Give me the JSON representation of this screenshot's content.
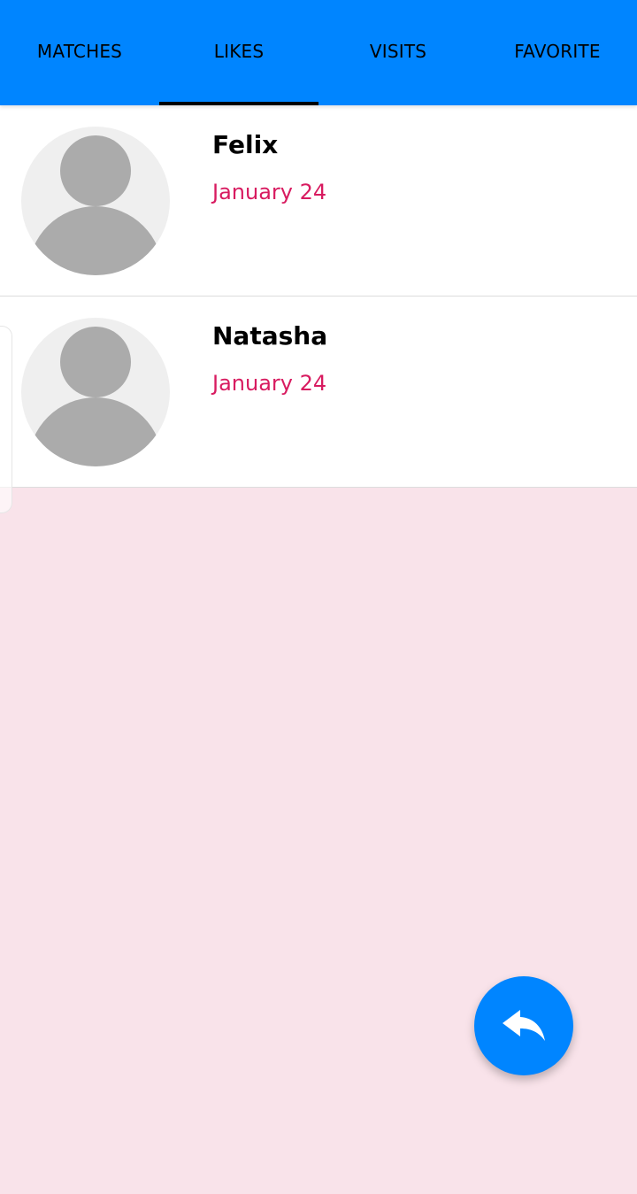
{
  "tabs": [
    {
      "label": "MATCHES",
      "selected": false
    },
    {
      "label": "LIKES",
      "selected": true
    },
    {
      "label": "VISITS",
      "selected": false
    },
    {
      "label": "FAVORITE",
      "selected": false
    }
  ],
  "likes": [
    {
      "name": "Felix",
      "date": "January 24"
    },
    {
      "name": "Natasha",
      "date": "January 24"
    }
  ],
  "fab": {
    "icon": "reply-icon"
  },
  "colors": {
    "tabbar": "#0085ff",
    "date": "#d81b60",
    "background": "#f9e3ea",
    "avatar_bg": "#efefef",
    "avatar_fg": "#ababab"
  }
}
